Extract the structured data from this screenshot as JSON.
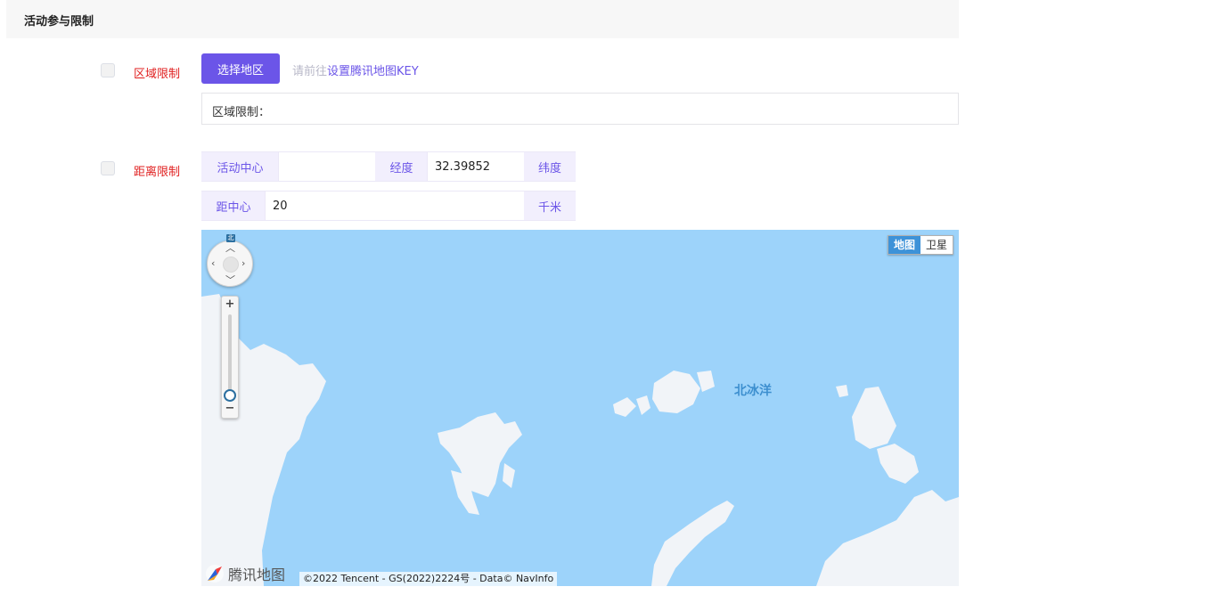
{
  "section": {
    "title": "活动参与限制"
  },
  "region": {
    "label": "区域限制",
    "select_button": "选择地区",
    "hint_prefix": "请前往",
    "hint_link": "设置腾讯地图KEY",
    "restriction_text": "区域限制："
  },
  "distance": {
    "label": "距离限制",
    "center_label": "活动中心",
    "center_value": "",
    "longitude_label": "经度",
    "longitude_value": "32.39852",
    "latitude_label": "纬度",
    "radius_label": "距中心",
    "radius_value": "20",
    "unit": "千米"
  },
  "map": {
    "type_map": "地图",
    "type_satellite": "卫星",
    "ocean_label": "北冰洋",
    "compass": "北",
    "zoom_in": "+",
    "zoom_out": "−",
    "brand": "腾讯地图",
    "copyright": "©2022 Tencent - GS(2022)2224号 - Data© NavInfo",
    "colors": {
      "water": "#9dd3fa",
      "land": "#f1f4f8"
    }
  },
  "colors": {
    "accent": "#6b55e8",
    "required_label": "#e02020"
  }
}
